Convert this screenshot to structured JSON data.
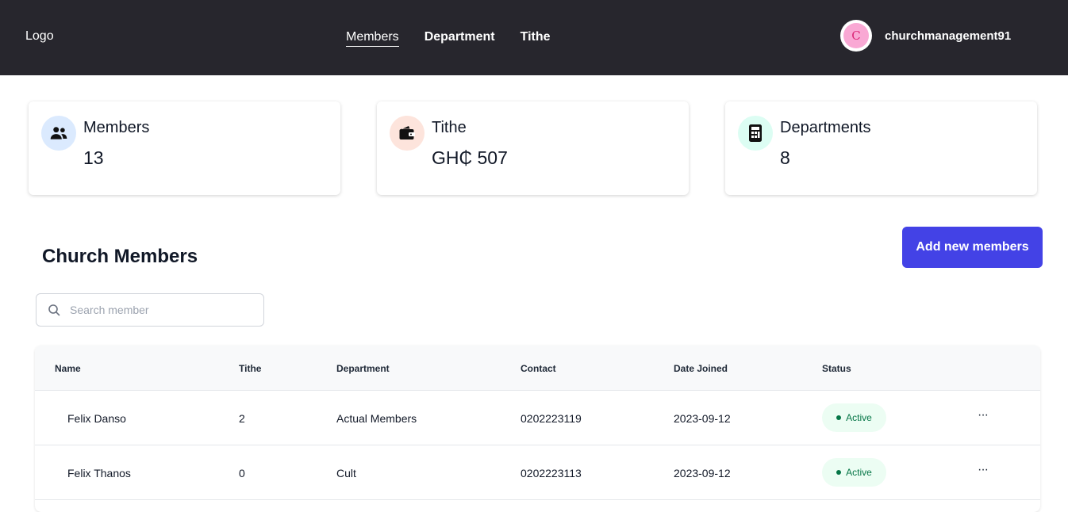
{
  "header": {
    "logo": "Logo",
    "nav": [
      {
        "label": "Members"
      },
      {
        "label": "Department"
      },
      {
        "label": "Tithe"
      }
    ],
    "user": {
      "avatar_initial": "C",
      "name": "churchmanagement91"
    }
  },
  "stats": [
    {
      "title": "Members",
      "value": "13",
      "icon": "users-icon",
      "color": "#dbeafe"
    },
    {
      "title": "Tithe",
      "value": "GH₵ 507",
      "icon": "wallet-icon",
      "color": "#fde4dc"
    },
    {
      "title": "Departments",
      "value": "8",
      "icon": "calculator-icon",
      "color": "#dcfce7"
    }
  ],
  "section": {
    "title": "Church Members",
    "add_button": "Add new members"
  },
  "search": {
    "placeholder": "Search member",
    "value": ""
  },
  "table": {
    "columns": [
      "Name",
      "Tithe",
      "Department",
      "Contact",
      "Date Joined",
      "Status"
    ],
    "rows": [
      {
        "name": "Felix Danso",
        "tithe": "2",
        "department": "Actual Members",
        "contact": "0202223119",
        "date_joined": "2023-09-12",
        "status": "Active",
        "more": "···"
      },
      {
        "name": "Felix Thanos",
        "tithe": "0",
        "department": "Cult",
        "contact": "0202223113",
        "date_joined": "2023-09-12",
        "status": "Active",
        "more": "···"
      }
    ]
  },
  "colors": {
    "header_bg": "#27262d",
    "accent": "#4342e6",
    "active_badge_bg": "#ecfdf3",
    "active_badge_text": "#067647"
  }
}
